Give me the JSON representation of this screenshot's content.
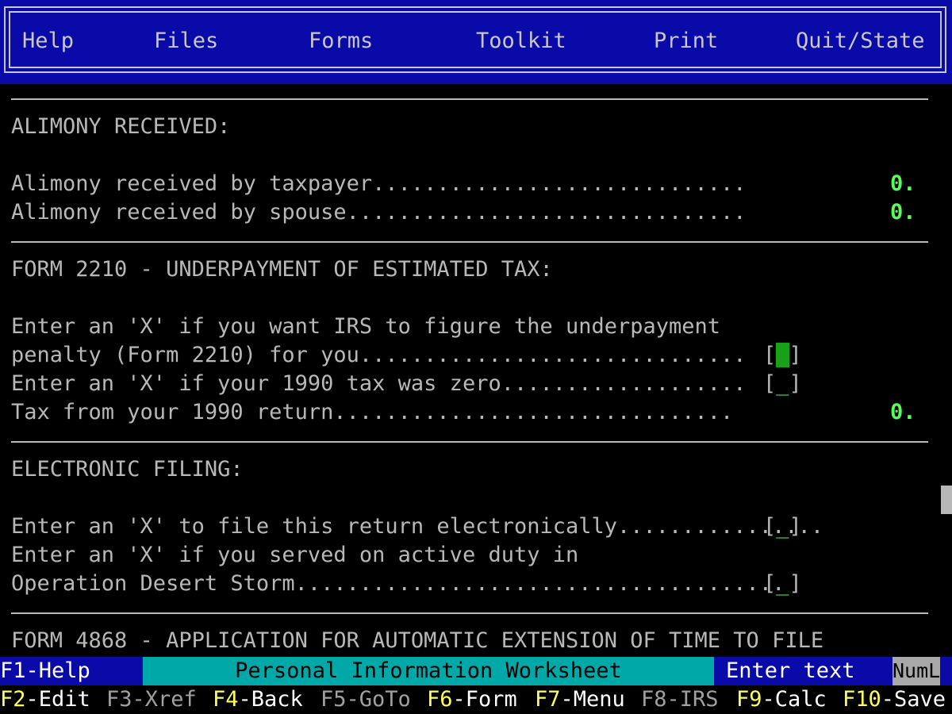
{
  "menu": {
    "items": [
      "Help",
      "Files",
      "Forms",
      "Toolkit",
      "Print",
      "Quit/State"
    ]
  },
  "sections": {
    "alimony": {
      "heading": "ALIMONY RECEIVED:",
      "taxpayer_label": "Alimony received by taxpayer.............................",
      "taxpayer_value": "0.",
      "spouse_label": "Alimony received by spouse...............................",
      "spouse_value": "0."
    },
    "form2210": {
      "heading": "FORM 2210 - UNDERPAYMENT OF ESTIMATED TAX:",
      "figure_line1": "Enter an 'X' if you want IRS to figure the underpayment",
      "figure_line2": "penalty (Form 2210) for you..............................",
      "zero_label": "Enter an 'X' if your 1990 tax was zero...................",
      "prior_tax_label": "Tax from your 1990 return...............................",
      "prior_tax_value": "0."
    },
    "efile": {
      "heading": "ELECTRONIC FILING:",
      "file_label": "Enter an 'X' to file this return electronically................",
      "desert_line1": "Enter an 'X' if you served on active duty in",
      "desert_line2": "Operation Desert Storm......................................"
    },
    "form4868": {
      "heading": "FORM 4868 - APPLICATION FOR AUTOMATIC EXTENSION OF TIME TO FILE"
    }
  },
  "checkbox": {
    "open": "[",
    "close": "]",
    "empty_mark": "_"
  },
  "status": {
    "f1": "F1-Help",
    "title": "Personal Information Worksheet",
    "mode": "Enter text",
    "numlock": "NumL"
  },
  "fkeys": [
    {
      "key": "F2",
      "label": "-Edit"
    },
    {
      "key": "F3",
      "label": "-Xref"
    },
    {
      "key": "F4",
      "label": "-Back"
    },
    {
      "key": "F5",
      "label": "-GoTo"
    },
    {
      "key": "F6",
      "label": "-Form"
    },
    {
      "key": "F7",
      "label": "-Menu"
    },
    {
      "key": "F8",
      "label": "-IRS"
    },
    {
      "key": "F9",
      "label": "-Calc"
    },
    {
      "key": "F10",
      "label": "-Save"
    }
  ],
  "colors": {
    "menu_bg": "#0a0aa8",
    "value_green": "#55ff55",
    "title_bg": "#00a8a8",
    "fkey_yellow": "#ffff55"
  }
}
